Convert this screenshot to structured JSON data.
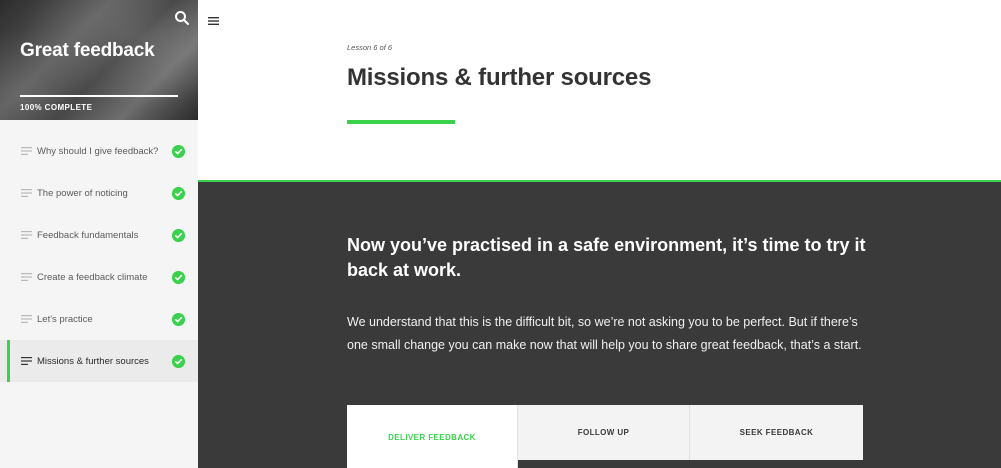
{
  "sidebar": {
    "hero_title": "Great feedback",
    "completion": "100% COMPLETE",
    "lessons": [
      {
        "label": "Why should I give feedback?",
        "complete": true
      },
      {
        "label": "The power of noticing",
        "complete": true
      },
      {
        "label": "Feedback fundamentals",
        "complete": true
      },
      {
        "label": "Create a feedback climate",
        "complete": true
      },
      {
        "label": "Let's practice",
        "complete": true
      },
      {
        "label": "Missions & further sources",
        "complete": true,
        "active": true
      }
    ]
  },
  "header": {
    "lesson_count": "Lesson 6 of 6",
    "title": "Missions & further sources"
  },
  "main": {
    "heading": "Now you’ve practised in a safe environment, it’s time to try it back at work.",
    "body": "We understand that this is the difficult bit, so we’re not asking you to be perfect. But if there’s one small change you can make now that will help you to share great feedback, that’s a start.",
    "tabs": [
      {
        "label": "DELIVER FEEDBACK",
        "active": true
      },
      {
        "label": "FOLLOW UP"
      },
      {
        "label": "SEEK FEEDBACK"
      }
    ]
  },
  "colors": {
    "accent": "#3ad24d",
    "dark_panel": "#3a3a3b",
    "sidebar_bg": "#f5f5f5"
  }
}
